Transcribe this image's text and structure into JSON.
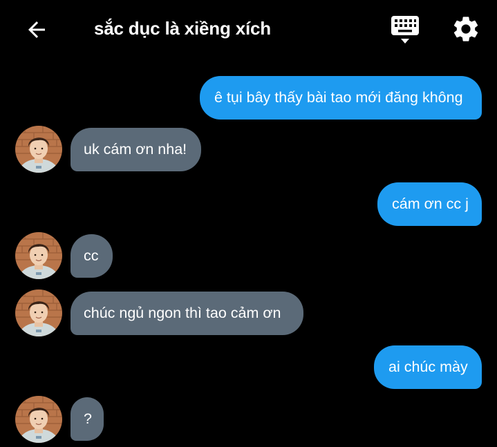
{
  "header": {
    "title": "sắc dục là xiềng xích",
    "back_icon": "arrow-back-icon",
    "keyboard_icon": "keyboard-icon",
    "settings_icon": "gear-icon"
  },
  "colors": {
    "background": "#000000",
    "outgoing_bubble": "#1e9bf0",
    "incoming_bubble": "#5b6a78"
  },
  "messages": [
    {
      "direction": "outgoing",
      "text": "ê tụi bây thấy bài tao mới đăng không"
    },
    {
      "direction": "incoming",
      "text": "uk cám ơn nha!"
    },
    {
      "direction": "outgoing",
      "text": "cám ơn cc j"
    },
    {
      "direction": "incoming",
      "text": "cc"
    },
    {
      "direction": "incoming",
      "text": "chúc ngủ ngon thì tao cảm ơn"
    },
    {
      "direction": "outgoing",
      "text": "ai chúc mày"
    },
    {
      "direction": "incoming",
      "text": "?"
    }
  ]
}
